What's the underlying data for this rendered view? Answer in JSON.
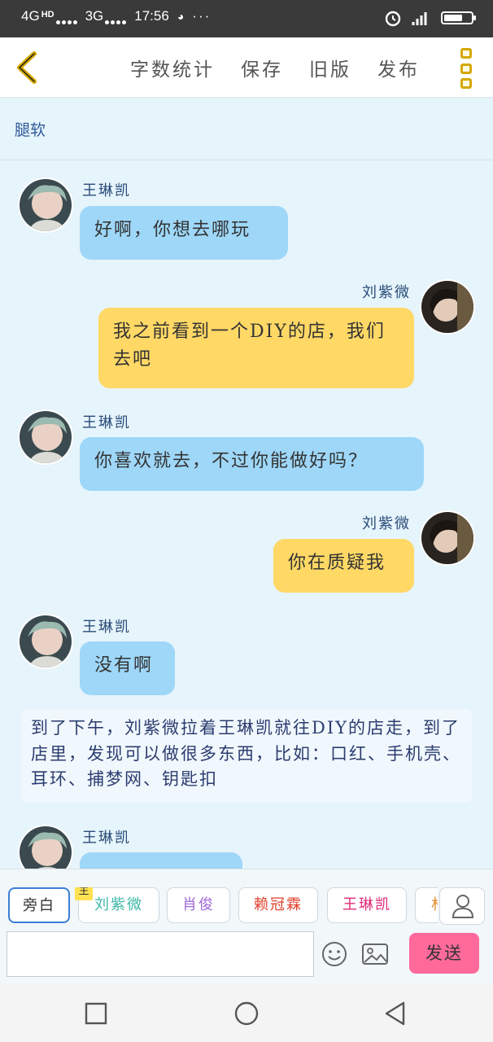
{
  "status_bar": {
    "network1": "4G",
    "network1_sup": "HD",
    "network2": "3G",
    "time": "17:56",
    "battery_level": "59"
  },
  "header": {
    "menu": [
      "字数统计",
      "保存",
      "旧版",
      "发布"
    ]
  },
  "story": {
    "title": "腿软"
  },
  "messages": [
    {
      "side": "left",
      "name": "王琳凯",
      "text": "好啊，你想去哪玩"
    },
    {
      "side": "right",
      "name": "刘紫微",
      "text": "我之前看到一个DIY的店，我们去吧"
    },
    {
      "side": "left",
      "name": "王琳凯",
      "text": "你喜欢就去，不过你能做好吗？"
    },
    {
      "side": "right",
      "name": "刘紫微",
      "text": "你在质疑我"
    },
    {
      "side": "left",
      "name": "王琳凯",
      "text": "没有啊"
    },
    {
      "side": "left",
      "name": "王琳凯",
      "text": "……"
    }
  ],
  "narration": "到了下午，刘紫微拉着王琳凯就往DIY的店走，到了店里，发现可以做很多东西，比如：口红、手机壳、耳环、捕梦网、钥匙扣",
  "composer": {
    "roles": [
      {
        "label": "旁白",
        "color": "#333333"
      },
      {
        "label": "刘紫微",
        "color": "#3fb8a8",
        "badge": "主"
      },
      {
        "label": "肖俊",
        "color": "#a06ad8"
      },
      {
        "label": "赖冠霖",
        "color": "#e0402c"
      },
      {
        "label": "王琳凯",
        "color": "#e02a7a"
      },
      {
        "label": "林",
        "color": "#e08a2a"
      }
    ],
    "input_placeholder": "",
    "send_label": "发送"
  },
  "colors": {
    "left_bubble": "#9ed7f8",
    "right_bubble": "#ffd866",
    "send_button": "#ff6a9b",
    "accent": "#d4a800"
  }
}
